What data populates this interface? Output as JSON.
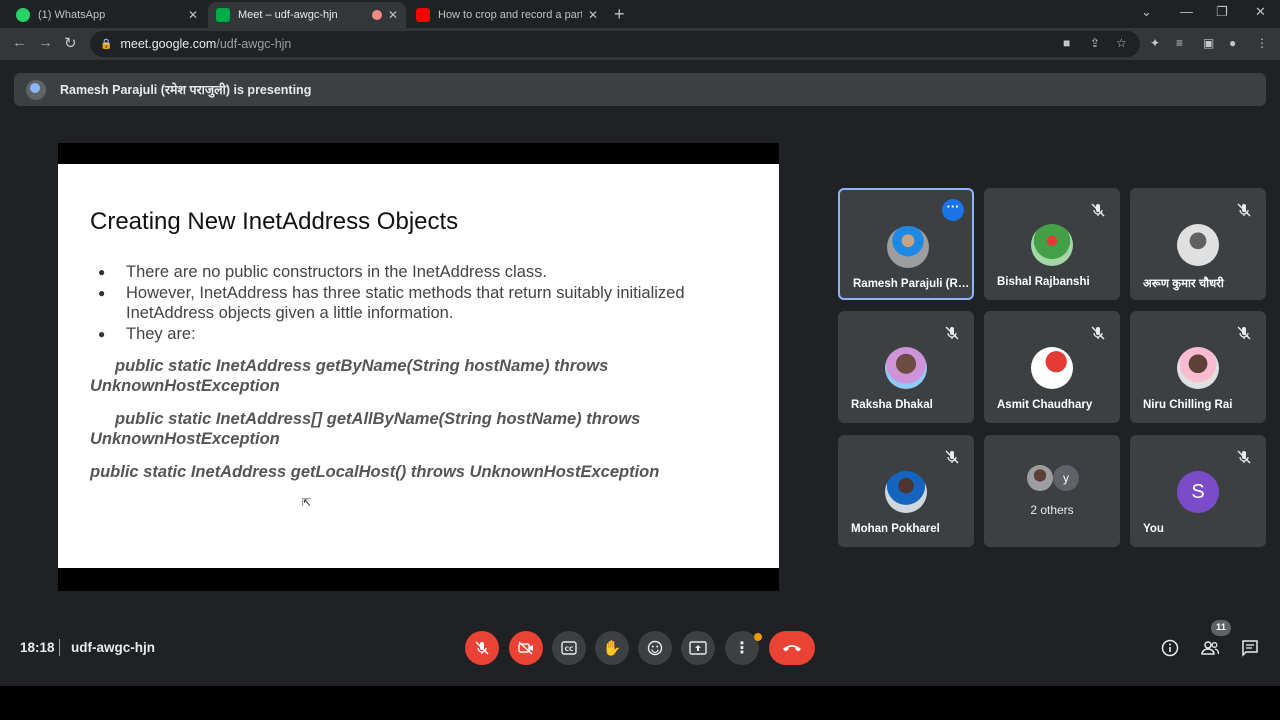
{
  "browser": {
    "tabs": [
      {
        "title": "(1) WhatsApp",
        "active": false,
        "favicon": "whatsapp-icon"
      },
      {
        "title": "Meet – udf-awgc-hjn",
        "active": true,
        "favicon": "meet-icon"
      },
      {
        "title": "How to crop and record a particu",
        "active": false,
        "favicon": "youtube-icon"
      }
    ],
    "url_host": "meet.google.com",
    "url_path": "/udf-awgc-hjn"
  },
  "meet": {
    "presenting_text": "Ramesh Parajuli (रमेश पराजुली) is presenting",
    "slide": {
      "title": "Creating New InetAddress Objects",
      "bullets": [
        "There are no public constructors in the InetAddress class.",
        "However, InetAddress has three static methods that return suitably initialized InetAddress objects given a little information.",
        "They are:"
      ],
      "code": [
        {
          "line1": "public static InetAddress getByName(String hostName) throws",
          "line2": "UnknownHostException"
        },
        {
          "line1": "public static InetAddress[] getAllByName(String hostName) throws",
          "line2": "UnknownHostException"
        },
        {
          "line1": "public static InetAddress getLocalHost() throws UnknownHostException",
          "line2": ""
        }
      ]
    },
    "participants": [
      {
        "name": "Ramesh Parajuli (R…",
        "muted": false,
        "active": true
      },
      {
        "name": "Bishal Rajbanshi",
        "muted": true
      },
      {
        "name": "अरूण कुमार चौधरी",
        "muted": true
      },
      {
        "name": "Raksha Dhakal",
        "muted": true
      },
      {
        "name": "Asmit Chaudhary",
        "muted": true
      },
      {
        "name": "Niru Chilling Rai",
        "muted": true
      },
      {
        "name": "Mohan Pokharel",
        "muted": true
      },
      {
        "name": "2 others",
        "muted": false,
        "initial": "y"
      },
      {
        "name": "You",
        "muted": true,
        "initial": "S"
      }
    ],
    "time": "18:18",
    "meeting_code": "udf-awgc-hjn",
    "people_count": "11",
    "colors": {
      "accent": "#8ab4f8",
      "danger": "#ea4335",
      "you_avatar": "#7b4cc9"
    }
  }
}
